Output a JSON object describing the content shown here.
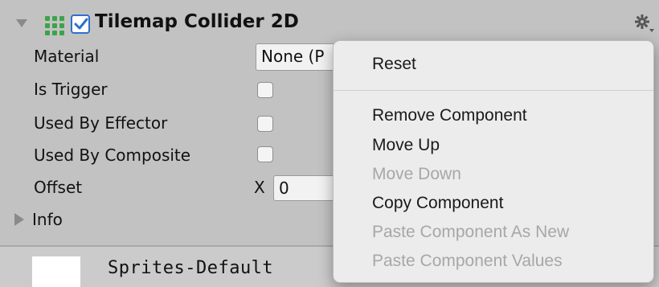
{
  "component": {
    "title": "Tilemap Collider 2D",
    "enabled": true,
    "fields": {
      "material_label": "Material",
      "material_value": "None (P",
      "is_trigger_label": "Is Trigger",
      "used_by_effector_label": "Used By Effector",
      "used_by_composite_label": "Used By Composite",
      "offset_label": "Offset",
      "offset_x_label": "X",
      "offset_x_value": "0",
      "info_label": "Info"
    }
  },
  "material_preview": {
    "name": "Sprites-Default"
  },
  "context_menu": {
    "items": [
      {
        "label": "Reset",
        "enabled": true
      },
      {
        "label": "Remove Component",
        "enabled": true
      },
      {
        "label": "Move Up",
        "enabled": true
      },
      {
        "label": "Move Down",
        "enabled": false
      },
      {
        "label": "Copy Component",
        "enabled": true
      },
      {
        "label": "Paste Component As New",
        "enabled": false
      },
      {
        "label": "Paste Component Values",
        "enabled": false
      }
    ]
  },
  "colors": {
    "panel_bg": "#c2c2c2",
    "menu_bg": "#ececec",
    "checkbox_accent": "#2f6fcf",
    "grid_icon_green": "#3da34b",
    "disabled_text": "#a7a7a7"
  }
}
